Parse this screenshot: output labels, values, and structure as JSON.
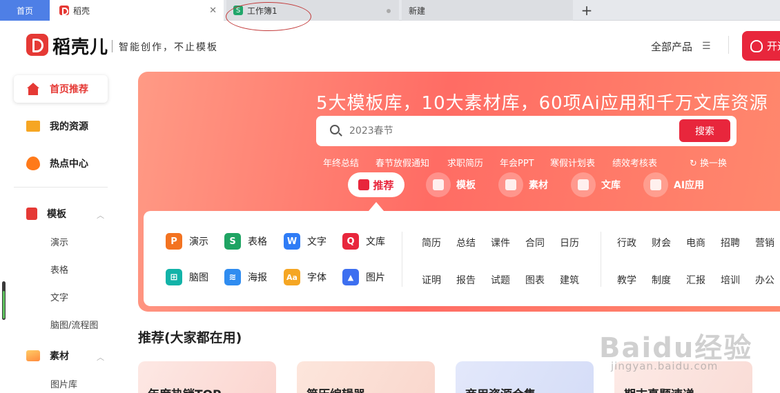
{
  "tabs": {
    "home": "首页",
    "active": "稻壳",
    "workbook": "工作簿1",
    "new_tab": "新建",
    "plus": "+"
  },
  "header": {
    "logo_text": "稻壳儿",
    "slogan": "智能创作，不止模板",
    "all_products": "全部产品",
    "open_button": "开通"
  },
  "sidebar": {
    "items": [
      {
        "label": "首页推荐",
        "icon": "home-icon"
      },
      {
        "label": "我的资源",
        "icon": "folder-icon"
      },
      {
        "label": "热点中心",
        "icon": "flame-icon"
      },
      {
        "label": "模板",
        "icon": "template-icon"
      },
      {
        "label": "素材",
        "icon": "image-icon"
      }
    ],
    "template_sub": [
      "演示",
      "表格",
      "文字",
      "脑图/流程图"
    ],
    "material_sub": [
      "图片库"
    ]
  },
  "hero": {
    "title": "5大模板库，10大素材库，60项Ai应用和千万文库资源",
    "search_placeholder": "2023春节",
    "search_button": "搜索",
    "hot_tags": [
      "年终总结",
      "春节放假通知",
      "求职简历",
      "年会PPT",
      "寒假计划表",
      "绩效考核表"
    ],
    "refresh": "换一换",
    "categories": [
      "推荐",
      "模板",
      "素材",
      "文库",
      "AI应用"
    ]
  },
  "apps": [
    {
      "label": "演示",
      "glyph": "P",
      "color": "#f37321"
    },
    {
      "label": "表格",
      "glyph": "S",
      "color": "#1fa463"
    },
    {
      "label": "文字",
      "glyph": "W",
      "color": "#2f7cf6"
    },
    {
      "label": "文库",
      "glyph": "Q",
      "color": "#e8263c"
    },
    {
      "label": "脑图",
      "glyph": "⊞",
      "color": "#12b3a8"
    },
    {
      "label": "海报",
      "glyph": "≋",
      "color": "#2f8cf0"
    },
    {
      "label": "字体",
      "glyph": "Aa",
      "color": "#f5a623"
    },
    {
      "label": "图片",
      "glyph": "▲",
      "color": "#3d6ff0"
    }
  ],
  "categories_col1": [
    "简历",
    "总结",
    "课件",
    "合同",
    "日历",
    "证明",
    "报告",
    "试题",
    "图表",
    "建筑"
  ],
  "categories_col2": [
    "行政",
    "财会",
    "电商",
    "招聘",
    "营销",
    "教学",
    "制度",
    "汇报",
    "培训",
    "办公"
  ],
  "recommend": {
    "title": "推荐(大家都在用)",
    "cards": [
      "年度热销TOP",
      "简历编辑器",
      "商用资源合集",
      "期末真题速递"
    ]
  },
  "watermark": {
    "text": "Baidu经验",
    "sub": "jingyan.baidu.com"
  }
}
